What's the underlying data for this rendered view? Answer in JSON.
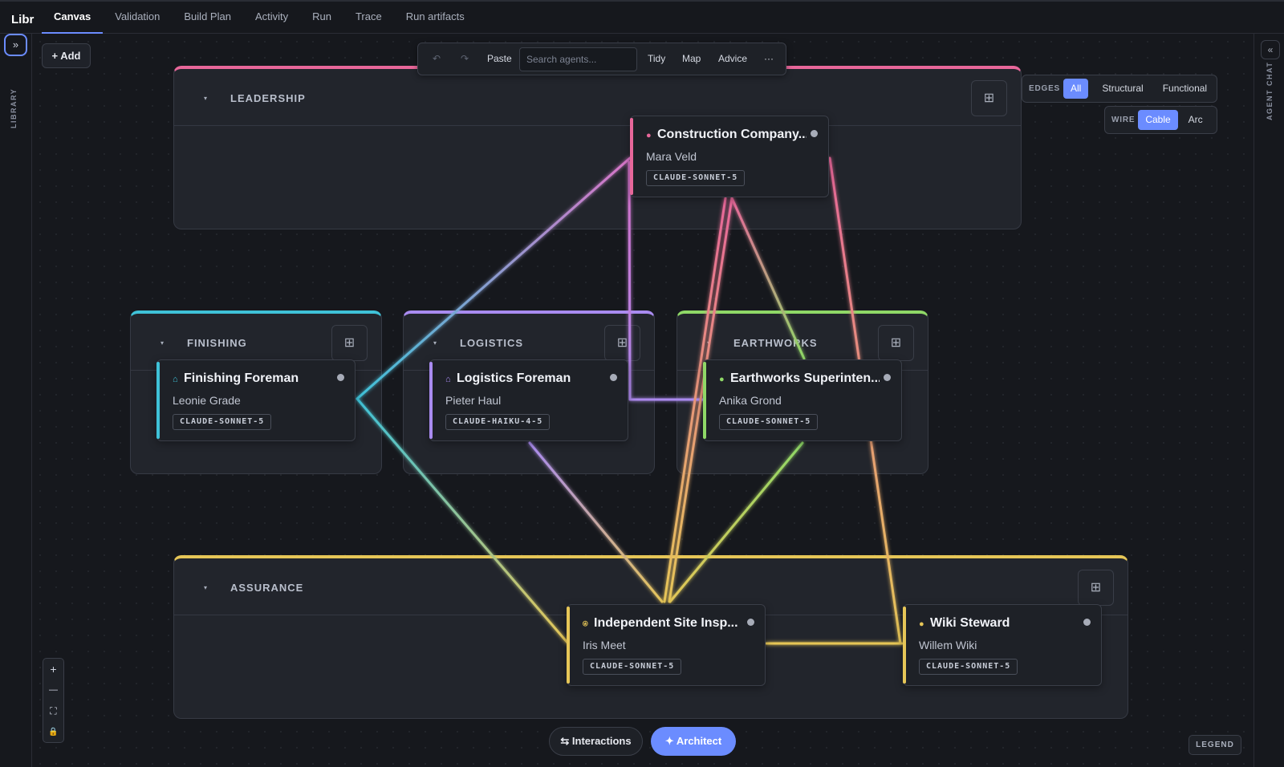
{
  "app": {
    "brand": "Libr"
  },
  "tabs": [
    {
      "label": "Canvas",
      "active": true
    },
    {
      "label": "Validation"
    },
    {
      "label": "Build Plan"
    },
    {
      "label": "Activity"
    },
    {
      "label": "Run"
    },
    {
      "label": "Trace"
    },
    {
      "label": "Run artifacts"
    }
  ],
  "left_rail": {
    "expand_icon": "»",
    "label": "LIBRARY"
  },
  "right_rail": {
    "collapse_icon": "«",
    "label": "AGENT CHAT"
  },
  "canvas": {
    "add_label": "+ Add"
  },
  "toolbar": {
    "undo_icon": "↶",
    "redo_icon": "↷",
    "paste_label": "Paste",
    "search_placeholder": "Search agents...",
    "tidy_label": "Tidy",
    "map_label": "Map",
    "advice_label": "Advice",
    "more_label": "···"
  },
  "edges_filter": {
    "label": "EDGES",
    "options": [
      "All",
      "Structural",
      "Functional"
    ],
    "selected": "All"
  },
  "wire_filter": {
    "label": "WIRE",
    "options": [
      "Cable",
      "Arc"
    ],
    "selected": "Cable"
  },
  "groups": {
    "leadership": {
      "title": "LEADERSHIP",
      "color": "#e8679a"
    },
    "finishing": {
      "title": "FINISHING",
      "color": "#3fc2d8"
    },
    "logistics": {
      "title": "LOGISTICS",
      "color": "#a98bf0"
    },
    "earthworks": {
      "title": "EARTHWORKS",
      "color": "#8fd867"
    },
    "assurance": {
      "title": "ASSURANCE",
      "color": "#e6c657"
    },
    "caret": "▾",
    "grid_icon": "⊞"
  },
  "nodes": {
    "construction": {
      "title": "Construction Company...",
      "person": "Mara Veld",
      "model": "CLAUDE-SONNET-5",
      "icon": "●",
      "color": "#e8679a"
    },
    "finishing": {
      "title": "Finishing Foreman",
      "person": "Leonie Grade",
      "model": "CLAUDE-SONNET-5",
      "icon": "⌂",
      "color": "#3fc2d8"
    },
    "logistics": {
      "title": "Logistics Foreman",
      "person": "Pieter Haul",
      "model": "CLAUDE-HAIKU-4-5",
      "icon": "⌂",
      "color": "#a98bf0"
    },
    "earthworks": {
      "title": "Earthworks Superinten...",
      "person": "Anika Grond",
      "model": "CLAUDE-SONNET-5",
      "icon": "●",
      "color": "#8fd867"
    },
    "inspector": {
      "title": "Independent Site Insp...",
      "person": "Iris Meet",
      "model": "CLAUDE-SONNET-5",
      "icon": "⍟",
      "color": "#e6c657"
    },
    "wiki": {
      "title": "Wiki Steward",
      "person": "Willem Wiki",
      "model": "CLAUDE-SONNET-5",
      "icon": "●",
      "color": "#e6c657"
    }
  },
  "zoom": {
    "in": "+",
    "out": "—",
    "fit": "⛶",
    "lock": "🔒"
  },
  "bottom": {
    "interactions_label": "⇆ Interactions",
    "architect_label": "✦ Architect",
    "legend_label": "LEGEND"
  }
}
